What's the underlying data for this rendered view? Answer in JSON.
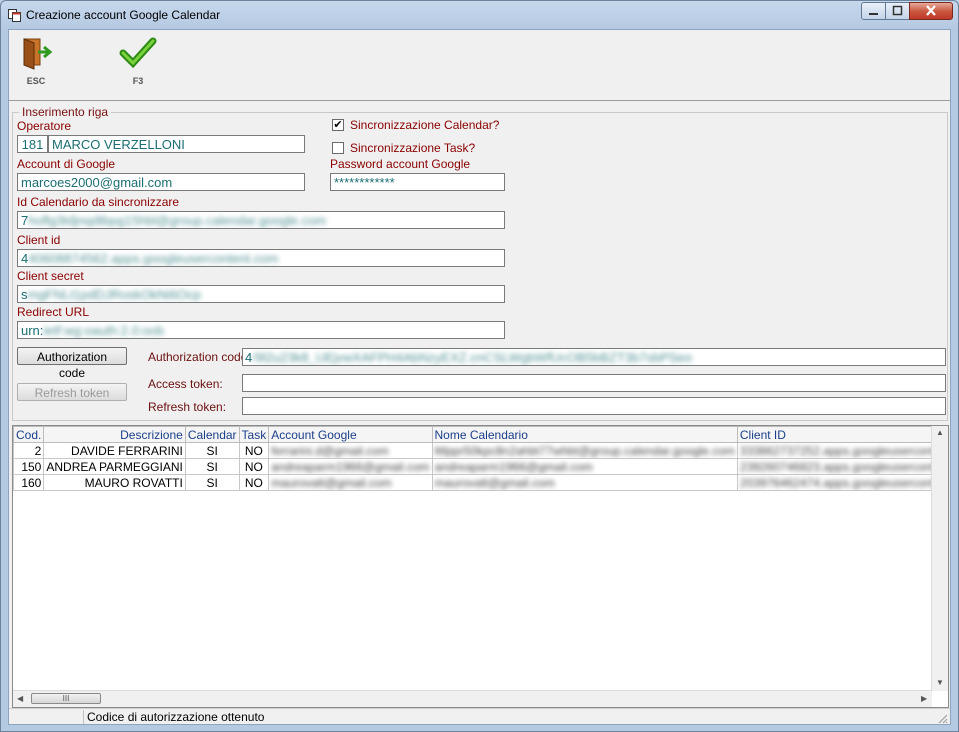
{
  "window": {
    "title": "Creazione account Google Calendar"
  },
  "toolbar": {
    "esc_label": "ESC",
    "f3_label": "F3"
  },
  "form": {
    "group_title": "Inserimento riga",
    "operatore_label": "Operatore",
    "operatore_code": "181",
    "operatore_name": "MARCO VERZELLONI",
    "sync_calendar_label": "Sincronizzazione Calendar?",
    "sync_calendar_checked": true,
    "sync_task_label": "Sincronizzazione Task?",
    "sync_task_checked": false,
    "account_label": "Account di Google",
    "account_value": "marcoes2000@gmail.com",
    "password_label": "Password account Google",
    "password_value": "************",
    "id_cal_label": "Id Calendario da sincronizzare",
    "id_cal_first": "7",
    "id_cal_hidden": "hoflg3tdjnqdtbpg15hbl@group.calendar.google.com",
    "client_id_label": "Client id",
    "client_id_first": "4",
    "client_id_hidden": "40608874562.apps.googleusercontent.com",
    "client_secret_label": "Client secret",
    "client_secret_first": "s",
    "client_secret_hidden": "mgFNLt1pdDJRoskOkNi6Ocp",
    "redirect_label": "Redirect URL",
    "redirect_first": "urn:",
    "redirect_hidden": "ietf:wg:oauth:2.0:oob",
    "auth_code_button": "Authorization code",
    "auth_code_label": "Authorization code",
    "auth_code_first": "4",
    "auth_code_hidden": "/9l2u23k8_UEjvwXAFPH4AbNzyEXZ.cnCSLWgbWfUcOB5bBZT3b7sbPSeo",
    "refresh_button": "Refresh token",
    "access_token_label": "Access token:",
    "access_token_value": "",
    "refresh_token_label": "Refresh token:",
    "refresh_token_value": ""
  },
  "grid": {
    "columns": [
      "Cod.",
      "Descrizione",
      "Calendar",
      "Task",
      "Account Google",
      "Nome Calendario",
      "Client ID"
    ],
    "rows": [
      {
        "cod": "2",
        "descrizione": "DAVIDE FERRARINI",
        "calendar": "SI",
        "task": "NO",
        "account": "ferrarini.d@gmail.com",
        "calendario": "lttlppr50kpc8n2ahbt77whbt@group.calendar.google.com",
        "client_id": "333862737252.apps.googleusercontent.com"
      },
      {
        "cod": "150",
        "descrizione": "ANDREA PARMEGGIANI",
        "calendar": "SI",
        "task": "NO",
        "account": "andreaparm1966@gmail.com",
        "calendario": "andreaparm1966@gmail.com",
        "client_id": "239260746823.apps.googleusercontent.com"
      },
      {
        "cod": "160",
        "descrizione": "MAURO ROVATTI",
        "calendar": "SI",
        "task": "NO",
        "account": "maurovatt@gmail.com",
        "calendario": "maurovatt@gmail.com",
        "client_id": "203976462474.apps.googleusercontent.com"
      }
    ]
  },
  "status": {
    "message": "Codice di autorizzazione ottenuto"
  }
}
